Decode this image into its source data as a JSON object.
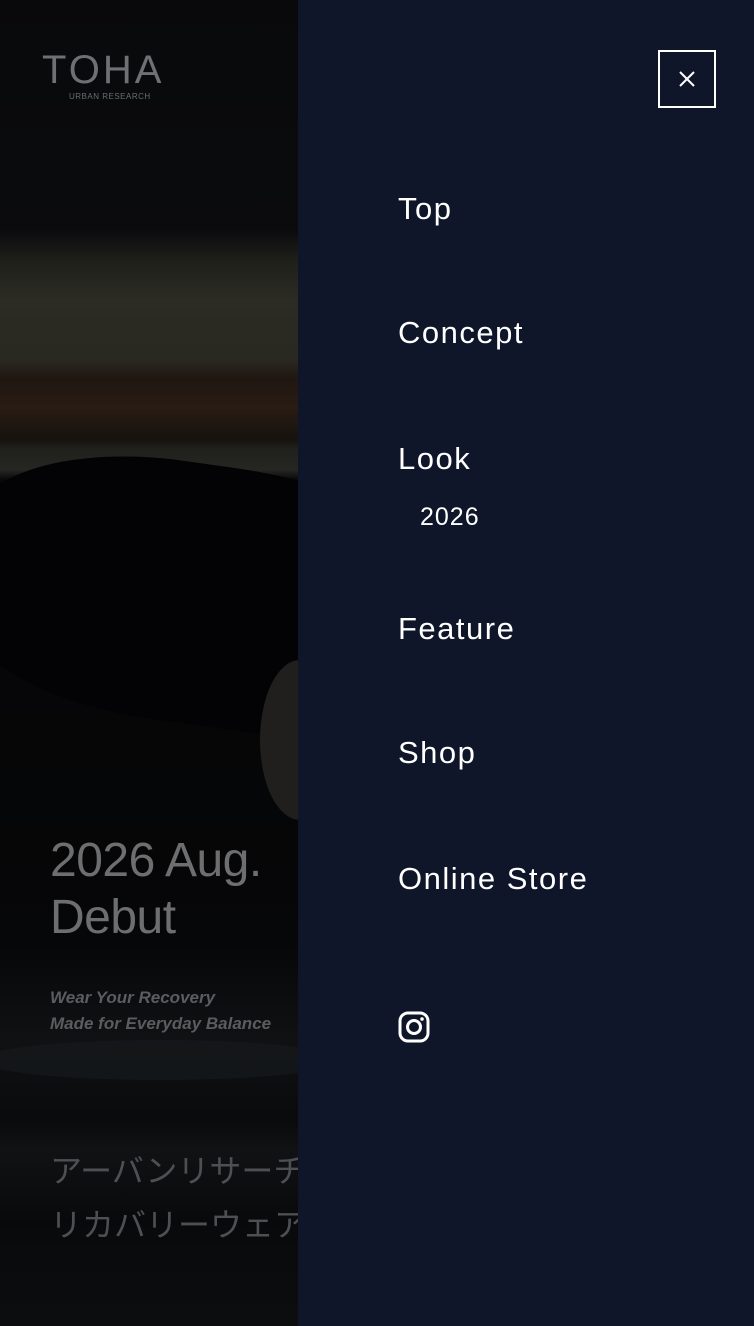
{
  "header": {
    "logo_text": "TOHA",
    "logo_subtext": "URBAN RESEARCH"
  },
  "hero": {
    "title": "2026 Aug.\nDebut",
    "tagline": [
      "Wear Your Recovery",
      "Made for Everyday Balance"
    ],
    "jp_lines": [
      "アーバンリサーチ",
      "リカバリーウェア"
    ]
  },
  "menu": {
    "close_label": "close-icon",
    "items": [
      {
        "label": "Top"
      },
      {
        "label": "Concept"
      },
      {
        "label": "Look"
      },
      {
        "label": "2026"
      },
      {
        "label": "Feature"
      },
      {
        "label": "Shop"
      },
      {
        "label": "Online Store"
      }
    ],
    "social_icon": "instagram-icon"
  },
  "colors": {
    "panel_bg": "#10162a",
    "menu_text": "#ffffff",
    "overlay": "rgba(0,0,0,0.45)"
  }
}
